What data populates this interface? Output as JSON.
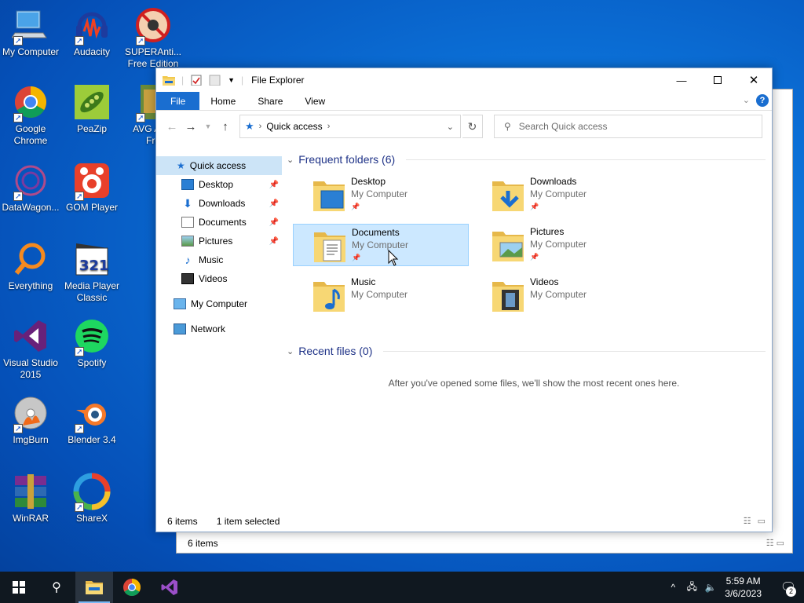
{
  "desktop": {
    "icons": [
      {
        "label": "My Computer",
        "icon": "computer-icon"
      },
      {
        "label": "Audacity",
        "icon": "audacity-icon"
      },
      {
        "label": "SUPERAnti...\nFree Edition",
        "icon": "superantispyware-icon"
      },
      {
        "label": "Google\nChrome",
        "icon": "chrome-icon"
      },
      {
        "label": "PeaZip",
        "icon": "peazip-icon"
      },
      {
        "label": "AVG An...\nFre",
        "icon": "avg-icon"
      },
      {
        "label": "DataWagon...",
        "icon": "datawagon-icon"
      },
      {
        "label": "GOM Player",
        "icon": "gom-player-icon"
      },
      {
        "label": "Everything",
        "icon": "everything-search-icon"
      },
      {
        "label": "Media Player\nClassic",
        "icon": "media-player-classic-icon"
      },
      {
        "label": "Visual Studio\n2015",
        "icon": "visual-studio-icon"
      },
      {
        "label": "Spotify",
        "icon": "spotify-icon"
      },
      {
        "label": "ImgBurn",
        "icon": "imgburn-icon"
      },
      {
        "label": "Blender 3.4",
        "icon": "blender-icon"
      },
      {
        "label": "WinRAR",
        "icon": "winrar-icon"
      },
      {
        "label": "ShareX",
        "icon": "sharex-icon"
      }
    ]
  },
  "back_window": {
    "status": "6 items"
  },
  "window": {
    "title": "File Explorer",
    "tabs": {
      "file": "File",
      "home": "Home",
      "share": "Share",
      "view": "View"
    },
    "help": "?",
    "address": {
      "location": "Quick access"
    },
    "search": {
      "placeholder": "Search Quick access"
    },
    "sidebar": {
      "quick_access": "Quick access",
      "items": [
        {
          "label": "Desktop",
          "pinned": true
        },
        {
          "label": "Downloads",
          "pinned": true
        },
        {
          "label": "Documents",
          "pinned": true
        },
        {
          "label": "Pictures",
          "pinned": true
        },
        {
          "label": "Music",
          "pinned": false
        },
        {
          "label": "Videos",
          "pinned": false
        }
      ],
      "my_computer": "My Computer",
      "network": "Network"
    },
    "frequent": {
      "header": "Frequent folders (6)",
      "folders": [
        {
          "name": "Desktop",
          "location": "My Computer",
          "pinned": true
        },
        {
          "name": "Downloads",
          "location": "My Computer",
          "pinned": true
        },
        {
          "name": "Documents",
          "location": "My Computer",
          "pinned": true,
          "selected": true
        },
        {
          "name": "Pictures",
          "location": "My Computer",
          "pinned": true
        },
        {
          "name": "Music",
          "location": "My Computer",
          "pinned": false
        },
        {
          "name": "Videos",
          "location": "My Computer",
          "pinned": false
        }
      ]
    },
    "recent": {
      "header": "Recent files (0)",
      "empty_message": "After you've opened some files, we'll show the most recent ones here."
    },
    "status": {
      "items": "6 items",
      "selected": "1 item selected"
    }
  },
  "taskbar": {
    "clock_time": "5:59 AM",
    "clock_date": "3/6/2023",
    "notification_count": "2"
  },
  "colors": {
    "accent": "#1a6ed0",
    "selection": "#cce8ff",
    "header_text": "#1e3287"
  }
}
